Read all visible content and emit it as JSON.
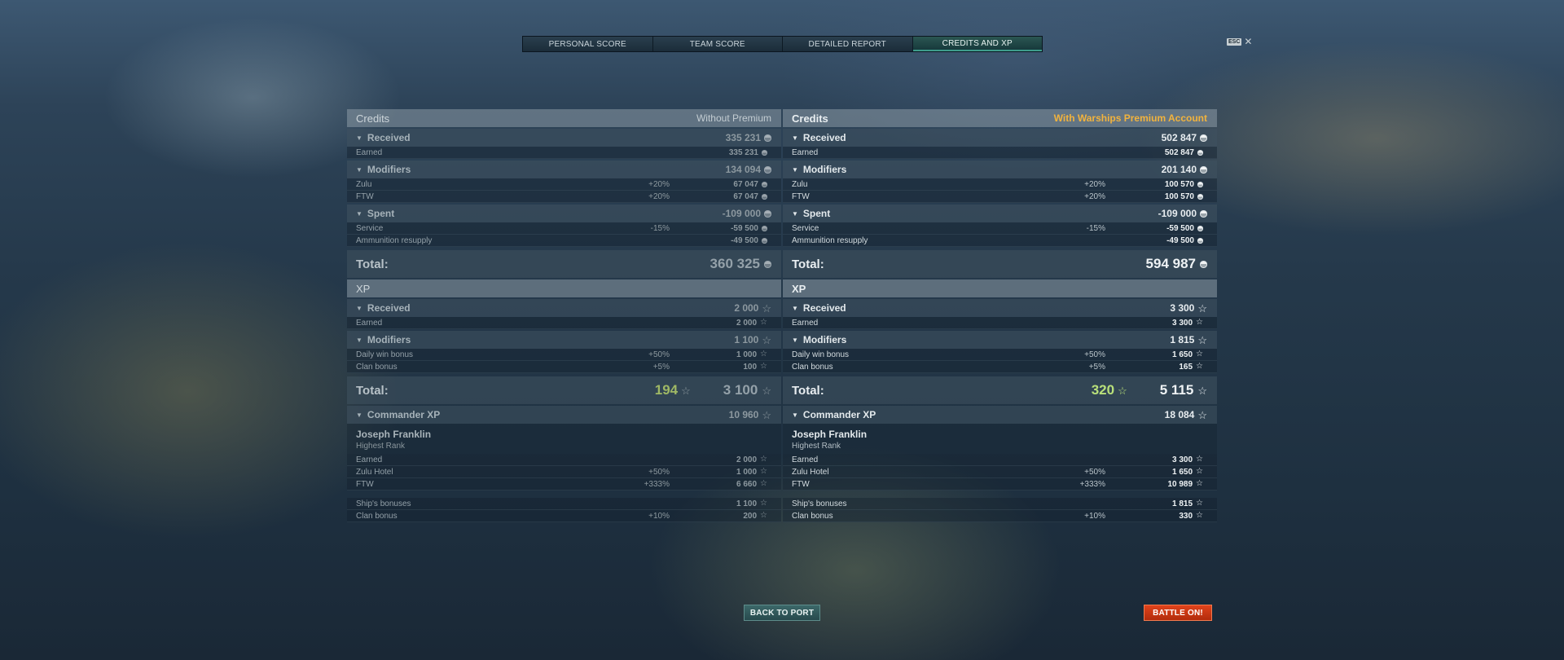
{
  "tabs": [
    "PERSONAL SCORE",
    "TEAM SCORE",
    "DETAILED REPORT",
    "CREDITS AND XP"
  ],
  "active_tab": 3,
  "esc_label": "ESC",
  "close_glyph": "✕",
  "left": {
    "credits_title": "Credits",
    "credits_subtitle": "Without Premium",
    "received": {
      "label": "Received",
      "value": "335 231"
    },
    "received_rows": [
      {
        "label": "Earned",
        "pct": "",
        "value": "335 231"
      }
    ],
    "modifiers": {
      "label": "Modifiers",
      "value": "134 094"
    },
    "modifier_rows": [
      {
        "label": "Zulu",
        "pct": "+20%",
        "value": "67 047"
      },
      {
        "label": "FTW",
        "pct": "+20%",
        "value": "67 047"
      }
    ],
    "spent": {
      "label": "Spent",
      "value": "-109 000"
    },
    "spent_rows": [
      {
        "label": "Service",
        "pct": "-15%",
        "value": "-59 500"
      },
      {
        "label": "Ammunition resupply",
        "pct": "",
        "value": "-49 500"
      }
    ],
    "credits_total_label": "Total:",
    "credits_total": "360 325",
    "xp_title": "XP",
    "xp_received": {
      "label": "Received",
      "value": "2 000"
    },
    "xp_received_rows": [
      {
        "label": "Earned",
        "pct": "",
        "value": "2 000"
      }
    ],
    "xp_modifiers": {
      "label": "Modifiers",
      "value": "1 100"
    },
    "xp_modifier_rows": [
      {
        "label": "Daily win bonus",
        "pct": "+50%",
        "value": "1 000"
      },
      {
        "label": "Clan bonus",
        "pct": "+5%",
        "value": "100"
      }
    ],
    "xp_total_label": "Total:",
    "free_xp": "194",
    "xp_total": "3 100",
    "commander": {
      "label": "Commander XP",
      "value": "10 960"
    },
    "commander_name": "Joseph Franklin",
    "commander_rank": "Highest Rank",
    "commander_rows": [
      {
        "label": "Earned",
        "pct": "",
        "value": "2 000"
      },
      {
        "label": "Zulu Hotel",
        "pct": "+50%",
        "value": "1 000"
      },
      {
        "label": "FTW",
        "pct": "+333%",
        "value": "6 660"
      }
    ],
    "ship_rows": [
      {
        "label": "Ship's bonuses",
        "pct": "",
        "value": "1 100"
      },
      {
        "label": "Clan bonus",
        "pct": "+10%",
        "value": "200"
      }
    ]
  },
  "right": {
    "credits_title": "Credits",
    "credits_subtitle": "With Warships Premium Account",
    "received": {
      "label": "Received",
      "value": "502 847"
    },
    "received_rows": [
      {
        "label": "Earned",
        "pct": "",
        "value": "502 847"
      }
    ],
    "modifiers": {
      "label": "Modifiers",
      "value": "201 140"
    },
    "modifier_rows": [
      {
        "label": "Zulu",
        "pct": "+20%",
        "value": "100 570"
      },
      {
        "label": "FTW",
        "pct": "+20%",
        "value": "100 570"
      }
    ],
    "spent": {
      "label": "Spent",
      "value": "-109 000"
    },
    "spent_rows": [
      {
        "label": "Service",
        "pct": "-15%",
        "value": "-59 500"
      },
      {
        "label": "Ammunition resupply",
        "pct": "",
        "value": "-49 500"
      }
    ],
    "credits_total_label": "Total:",
    "credits_total": "594 987",
    "xp_title": "XP",
    "xp_received": {
      "label": "Received",
      "value": "3 300"
    },
    "xp_received_rows": [
      {
        "label": "Earned",
        "pct": "",
        "value": "3 300"
      }
    ],
    "xp_modifiers": {
      "label": "Modifiers",
      "value": "1 815"
    },
    "xp_modifier_rows": [
      {
        "label": "Daily win bonus",
        "pct": "+50%",
        "value": "1 650"
      },
      {
        "label": "Clan bonus",
        "pct": "+5%",
        "value": "165"
      }
    ],
    "xp_total_label": "Total:",
    "free_xp": "320",
    "xp_total": "5 115",
    "commander": {
      "label": "Commander XP",
      "value": "18 084"
    },
    "commander_name": "Joseph Franklin",
    "commander_rank": "Highest Rank",
    "commander_rows": [
      {
        "label": "Earned",
        "pct": "",
        "value": "3 300"
      },
      {
        "label": "Zulu Hotel",
        "pct": "+50%",
        "value": "1 650"
      },
      {
        "label": "FTW",
        "pct": "+333%",
        "value": "10 989"
      }
    ],
    "ship_rows": [
      {
        "label": "Ship's bonuses",
        "pct": "",
        "value": "1 815"
      },
      {
        "label": "Clan bonus",
        "pct": "+10%",
        "value": "330"
      }
    ]
  },
  "buttons": {
    "back": "BACK TO PORT",
    "battle": "BATTLE ON!"
  },
  "icons": {
    "credits": "credits-coin-icon",
    "xp": "xp-star-icon",
    "collapse": "collapse-triangle-icon"
  },
  "colors": {
    "premium_label": "#f2b33d",
    "free_xp": "#b9e07a",
    "battle_button": "#d63a16",
    "port_button": "#2f5c5d",
    "active_tab": "#2b5652"
  }
}
